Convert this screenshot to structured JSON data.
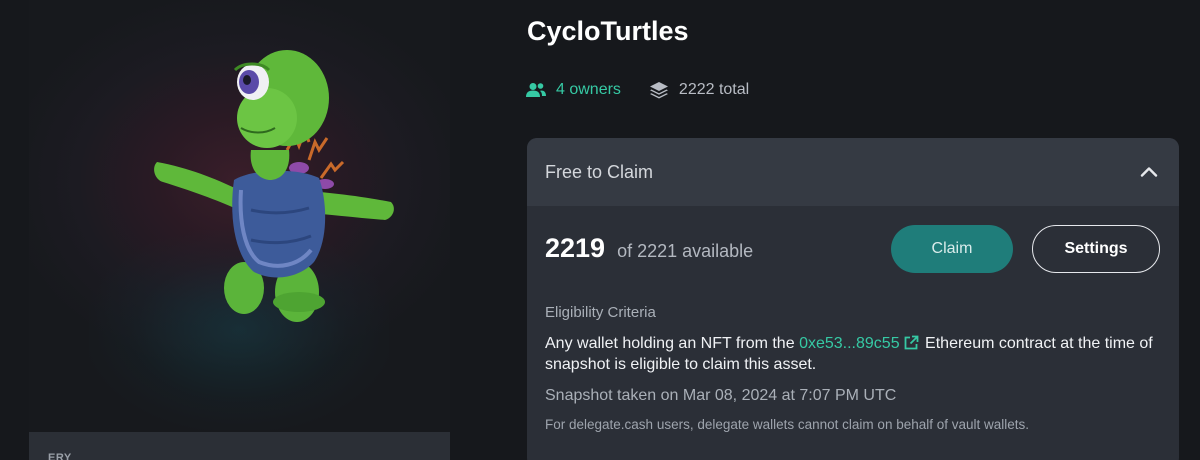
{
  "media": {
    "footer_label": "ERY",
    "artwork_icon": "turtle-artwork"
  },
  "collection": {
    "title": "CycloTurtles",
    "owners": "4 owners",
    "owners_icon": "users-icon",
    "total": "2222 total",
    "total_icon": "layers-icon"
  },
  "claim": {
    "section_title": "Free to Claim",
    "available_count": "2219",
    "available_text": "of 2221 available",
    "claim_button": "Claim",
    "settings_button": "Settings",
    "eligibility_label": "Eligibility Criteria",
    "eligibility_prefix": "Any wallet holding an NFT from the",
    "contract_address": "0xe53...89c55",
    "eligibility_suffix": "Ethereum contract at the time of snapshot is eligible to claim this asset.",
    "snapshot": "Snapshot taken on Mar 08, 2024 at 7:07 PM UTC",
    "delegate_note": "For delegate.cash users, delegate wallets cannot claim on behalf of vault wallets."
  },
  "colors": {
    "background": "#16181c",
    "accent": "#36c9a4",
    "claim_button": "#1f7d7a",
    "card": "#2b2f37",
    "card_header": "#353a43"
  }
}
